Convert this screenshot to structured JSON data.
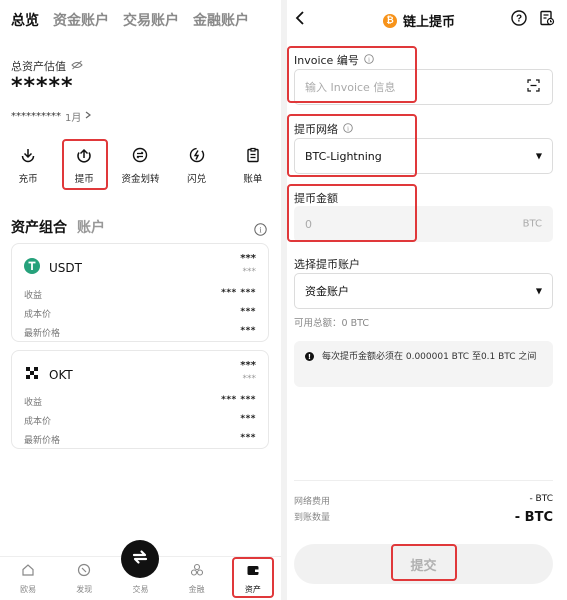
{
  "left": {
    "top_tabs": [
      "总览",
      "资金账户",
      "交易账户",
      "金融账户"
    ],
    "asset_label": "总资产估值",
    "asset_value": "*****",
    "asset_sub_value": "**********",
    "asset_sub_period": "1月",
    "actions": [
      {
        "label": "充币",
        "icon": "deposit-icon"
      },
      {
        "label": "提币",
        "icon": "withdraw-icon"
      },
      {
        "label": "资金划转",
        "icon": "transfer-icon"
      },
      {
        "label": "闪兑",
        "icon": "flash-swap-icon"
      },
      {
        "label": "账单",
        "icon": "bill-icon"
      }
    ],
    "portfolio_tabs": [
      "资产组合",
      "账户"
    ],
    "cards": [
      {
        "coin": "USDT",
        "color": "#26a17b",
        "amount": "***",
        "amount_sub": "***",
        "rows": [
          {
            "label": "收益",
            "value": "*** ***"
          },
          {
            "label": "成本价",
            "value": "***"
          },
          {
            "label": "最新价格",
            "value": "***"
          }
        ]
      },
      {
        "coin": "OKT",
        "color": "#111111",
        "amount": "***",
        "amount_sub": "***",
        "rows": [
          {
            "label": "收益",
            "value": "*** ***"
          },
          {
            "label": "成本价",
            "value": "***"
          },
          {
            "label": "最新价格",
            "value": "***"
          }
        ]
      }
    ],
    "bottom_nav": [
      {
        "label": "欧易",
        "icon": "home-icon"
      },
      {
        "label": "发现",
        "icon": "discover-icon"
      },
      {
        "label": "交易",
        "icon": "trade-icon"
      },
      {
        "label": "金融",
        "icon": "finance-icon"
      },
      {
        "label": "资产",
        "icon": "wallet-icon"
      }
    ]
  },
  "right": {
    "title": "链上提币",
    "invoice": {
      "label": "Invoice 编号",
      "placeholder": "输入 Invoice 信息"
    },
    "network": {
      "label": "提币网络",
      "value": "BTC-Lightning"
    },
    "amount": {
      "label": "提币金额",
      "placeholder": "0",
      "unit": "BTC"
    },
    "account": {
      "label": "选择提币账户",
      "value": "资金账户"
    },
    "available": "可用总额：0 BTC",
    "notice": "每次提币金额必须在 0.000001 BTC 至0.1 BTC 之间",
    "fee_label": "网络费用",
    "fee_value": "- BTC",
    "receive_label": "到账数量",
    "receive_value": "- BTC",
    "submit_label": "提交"
  },
  "colors": {
    "highlight": "#e0383a",
    "btc": "#f7931a",
    "usdt": "#26a17b"
  }
}
